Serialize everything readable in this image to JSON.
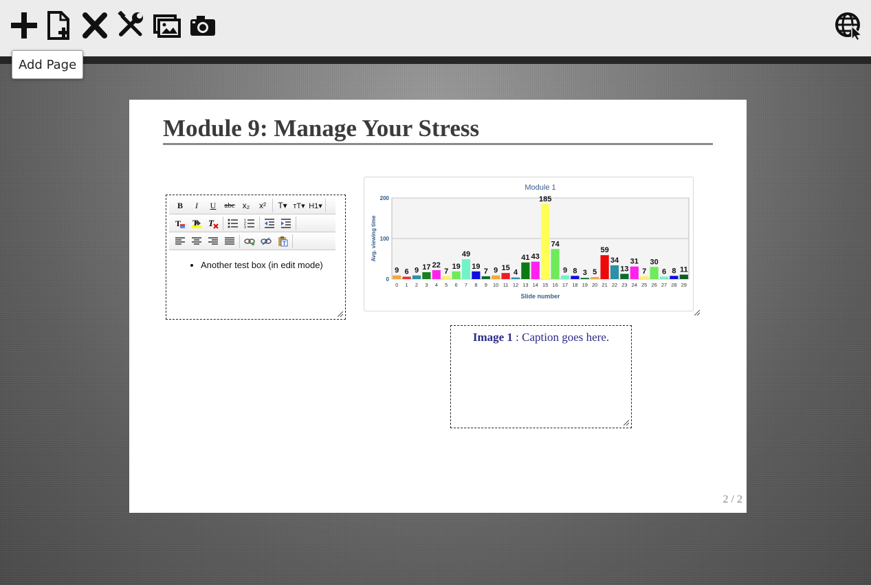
{
  "toolbar": {
    "buttons": [
      {
        "name": "plus-icon",
        "label": "Add Page"
      },
      {
        "name": "new-page-icon",
        "label": "New Page"
      },
      {
        "name": "close-icon",
        "label": "Delete"
      },
      {
        "name": "tools-icon",
        "label": "Tools"
      },
      {
        "name": "images-icon",
        "label": "Images"
      },
      {
        "name": "camera-icon",
        "label": "Camera"
      }
    ],
    "tooltip": "Add Page",
    "right_icon": "globe-cursor-icon"
  },
  "page": {
    "title": "Module 9: Manage Your Stress",
    "page_number": "2 / 2"
  },
  "editor": {
    "toolbar_row1": [
      "B",
      "I",
      "U",
      "abc",
      "x₂",
      "x²",
      "T▾",
      "тT▾",
      "H1▾"
    ],
    "toolbar_row2": [
      "text-color-icon",
      "highlight-icon",
      "clear-format-icon",
      "bulleted-list-icon",
      "numbered-list-icon",
      "outdent-icon",
      "indent-icon"
    ],
    "toolbar_row3": [
      "align-left-icon",
      "align-center-icon",
      "align-right-icon",
      "justify-icon",
      "link-icon",
      "unlink-icon",
      "paste-text-icon"
    ],
    "content": "Another test box (in edit mode)"
  },
  "caption": {
    "label": "Image 1",
    "text": " : Caption goes here."
  },
  "chart_data": {
    "type": "bar",
    "title": "Module 1",
    "xlabel": "Slide number",
    "ylabel": "Avg. viewing time",
    "ylim": [
      0,
      200
    ],
    "yticks": [
      0,
      100,
      200
    ],
    "grid": true,
    "categories": [
      "0",
      "1",
      "2",
      "3",
      "4",
      "5",
      "6",
      "7",
      "8",
      "9",
      "10",
      "11",
      "12",
      "13",
      "14",
      "15",
      "16",
      "17",
      "18",
      "19",
      "20",
      "21",
      "22",
      "23",
      "24",
      "25",
      "26",
      "27",
      "28",
      "29"
    ],
    "values": [
      9,
      6,
      9,
      17,
      22,
      7,
      19,
      49,
      19,
      7,
      9,
      15,
      4,
      41,
      43,
      185,
      74,
      9,
      8,
      3,
      5,
      59,
      34,
      13,
      31,
      7,
      30,
      6,
      8,
      11
    ],
    "colors": [
      "#f2a93b",
      "#e8322f",
      "#2e8fa6",
      "#17801f",
      "#ff22ee",
      "#ffef6a",
      "#6fea5a",
      "#70f3c7",
      "#1010e0",
      "#0f6a2a",
      "#f2a93b",
      "#ee1c25",
      "#2e8fa6",
      "#0a7a12",
      "#ff22ee",
      "#ffff55",
      "#6fea5a",
      "#70f3c7",
      "#1010e0",
      "#0f6a2a",
      "#f2a93b",
      "#ee0a0a",
      "#2e8fa6",
      "#0a6a2a",
      "#ff22ee",
      "#ffef6a",
      "#6fea5a",
      "#70f3c7",
      "#1010e0",
      "#0f5a22"
    ]
  }
}
